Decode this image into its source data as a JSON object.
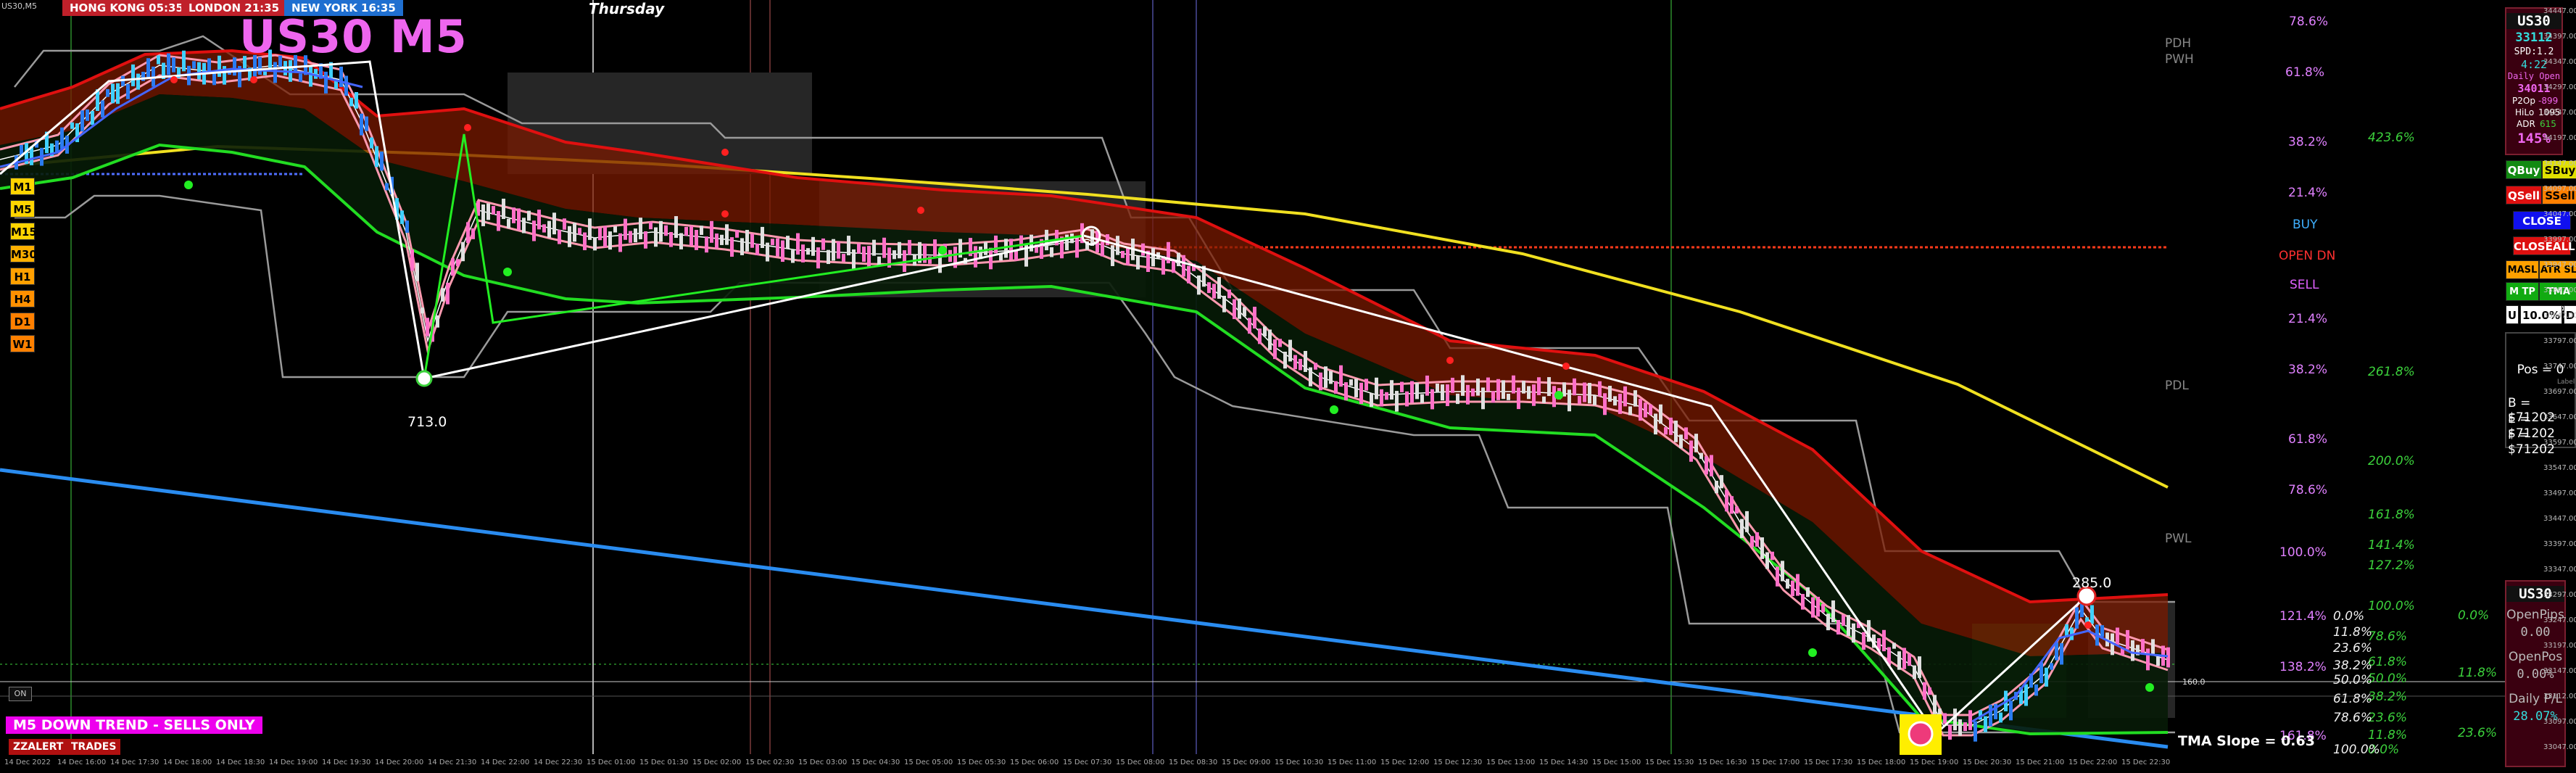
{
  "window": {
    "title": "US30,M5"
  },
  "sessions": [
    {
      "label": "HONG KONG 05:35",
      "color": "#c0202a"
    },
    {
      "label": "LONDON  21:35",
      "color": "#c0202a"
    },
    {
      "label": "NEW YORK 16:35",
      "color": "#1f6fd0"
    }
  ],
  "symbol_title": "US30 M5",
  "day_label": "Thursday",
  "timeframes": [
    {
      "label": "M1",
      "color": "#ffd400"
    },
    {
      "label": "M5",
      "color": "#ffd400"
    },
    {
      "label": "M15",
      "color": "#ffd400"
    },
    {
      "label": "M30",
      "color": "#ffb000"
    },
    {
      "label": "H1",
      "color": "#ffa000"
    },
    {
      "label": "H4",
      "color": "#ff9000"
    },
    {
      "label": "D1",
      "color": "#ff8000"
    },
    {
      "label": "W1",
      "color": "#ff8000"
    }
  ],
  "annotations": {
    "low_label": "713.0",
    "high_label": "285.0",
    "tma_slope": "TMA Slope = 0.63",
    "trend": "M5  DOWN TREND - SELLS ONLY",
    "on_button": "ON",
    "level_160": "160.0"
  },
  "levels": {
    "pdh": "PDH",
    "pwh": "PWH",
    "pdl": "PDL",
    "pwl": "PWL",
    "buy": "BUY",
    "open_dn": "OPEN DN",
    "sell": "SELL"
  },
  "fib_left": [
    "78.6%",
    "61.8%",
    "38.2%",
    "21.4%",
    "21.4%",
    "38.2%",
    "61.8%",
    "78.6%",
    "100.0%",
    "121.4%",
    "138.2%",
    "161.8%"
  ],
  "fib_mid_green": [
    "423.6%",
    "261.8%",
    "200.0%",
    "161.8%",
    "141.4%",
    "127.2%",
    "100.0%",
    "78.6%",
    "61.8%",
    "50.0%",
    "38.2%",
    "23.6%",
    "11.8%",
    "0.0%"
  ],
  "fib_mid_white": [
    "0.0%",
    "11.8%",
    "23.6%",
    "38.2%",
    "50.0%",
    "61.8%",
    "78.6%",
    "100.0%"
  ],
  "fib_far_green": [
    "0.0%",
    "11.8%",
    "23.6%"
  ],
  "info_panel": {
    "symbol": "US30",
    "price": "33112",
    "spread": "SPD:1.2",
    "time": "4:22",
    "daily_open_label": "Daily Open",
    "daily_open": "34011",
    "p2op_label": "P2Op",
    "p2op": "-899",
    "hilo_label": "HiLo",
    "hilo": "1095",
    "adr_label": "ADR",
    "adr": "615",
    "pct": "145%"
  },
  "trade_buttons": {
    "qbuy": "QBuy",
    "sbuy": "SBuy",
    "qsell": "QSell",
    "ssell": "SSell",
    "close": "CLOSE",
    "closeall": "CLOSEALL",
    "masl": "MASL",
    "atrsl": "ATR SL",
    "mtp": "M TP",
    "tmatp": "TMA TP",
    "u": "U",
    "lot": "10.0%",
    "d": "D"
  },
  "position": {
    "pos": "Pos = 0",
    "label": "Label",
    "b": "B = $71202",
    "e": "E = $71202",
    "f": "F = $71202"
  },
  "pnl_panel": {
    "symbol": "US30",
    "open_pips_label": "OpenPips",
    "open_pips": "0.00",
    "open_pos_label": "OpenPos",
    "open_pos": "0.00%",
    "daily_pl_label": "Daily P/L",
    "daily_pl": "28.07%"
  },
  "bottom_buttons": {
    "zzalert": "ZZALERT",
    "trades": "TRADES"
  },
  "x_ticks": [
    "14 Dec 2022",
    "14 Dec 16:00",
    "14 Dec 17:30",
    "14 Dec 18:00",
    "14 Dec 18:30",
    "14 Dec 19:00",
    "14 Dec 19:30",
    "14 Dec 20:00",
    "14 Dec 21:30",
    "14 Dec 22:00",
    "14 Dec 22:30",
    "15 Dec 01:00",
    "15 Dec 01:30",
    "15 Dec 02:00",
    "15 Dec 02:30",
    "15 Dec 03:00",
    "15 Dec 04:30",
    "15 Dec 05:00",
    "15 Dec 05:30",
    "15 Dec 06:00",
    "15 Dec 07:30",
    "15 Dec 08:00",
    "15 Dec 08:30",
    "15 Dec 09:00",
    "15 Dec 10:30",
    "15 Dec 11:00",
    "15 Dec 12:00",
    "15 Dec 12:30",
    "15 Dec 13:00",
    "15 Dec 14:30",
    "15 Dec 15:00",
    "15 Dec 15:30",
    "15 Dec 16:30",
    "15 Dec 17:00",
    "15 Dec 17:30",
    "15 Dec 18:00",
    "15 Dec 19:00",
    "15 Dec 20:30",
    "15 Dec 21:00",
    "15 Dec 22:00",
    "15 Dec 22:30"
  ],
  "y_ticks": [
    "34447.00",
    "34397.00",
    "34347.00",
    "34297.00",
    "34247.00",
    "34197.00",
    "34147.00",
    "34097.00",
    "34047.00",
    "33997.00",
    "33947.00",
    "33897.00",
    "33847.00",
    "33797.00",
    "33747.00",
    "33697.00",
    "33647.00",
    "33597.00",
    "33547.00",
    "33497.00",
    "33447.00",
    "33397.00",
    "33347.00",
    "33297.00",
    "33247.00",
    "33197.00",
    "33147.00",
    "33112.00",
    "33097.00",
    "33047.00"
  ],
  "colors": {
    "bg": "#000000",
    "upper_band": "#e01010",
    "lower_band": "#22dd22",
    "ma_yellow": "#f0e020",
    "trend_blue": "#2a8cf0",
    "zigzag": "#ffffff",
    "fill_red": "#7a1a00",
    "fill_green": "#0c3a0c"
  }
}
